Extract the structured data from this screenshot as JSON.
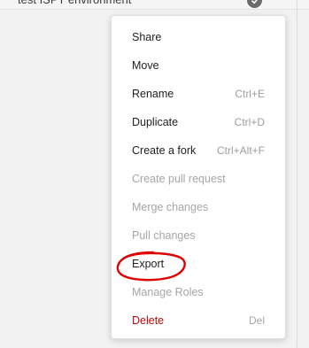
{
  "background_row": {
    "name": "test ISPT environment"
  },
  "menu": {
    "items": [
      {
        "label": "Share",
        "shortcut": "",
        "state": "normal"
      },
      {
        "label": "Move",
        "shortcut": "",
        "state": "normal"
      },
      {
        "label": "Rename",
        "shortcut": "Ctrl+E",
        "state": "normal"
      },
      {
        "label": "Duplicate",
        "shortcut": "Ctrl+D",
        "state": "normal"
      },
      {
        "label": "Create a fork",
        "shortcut": "Ctrl+Alt+F",
        "state": "normal"
      },
      {
        "label": "Create pull request",
        "shortcut": "",
        "state": "disabled"
      },
      {
        "label": "Merge changes",
        "shortcut": "",
        "state": "disabled"
      },
      {
        "label": "Pull changes",
        "shortcut": "",
        "state": "disabled"
      },
      {
        "label": "Export",
        "shortcut": "",
        "state": "normal"
      },
      {
        "label": "Manage Roles",
        "shortcut": "",
        "state": "disabled"
      },
      {
        "label": "Delete",
        "shortcut": "Del",
        "state": "danger"
      }
    ]
  },
  "colors": {
    "danger": "#b80b0b",
    "annotation": "#e00000",
    "disabled_text": "#a6a6a6"
  }
}
